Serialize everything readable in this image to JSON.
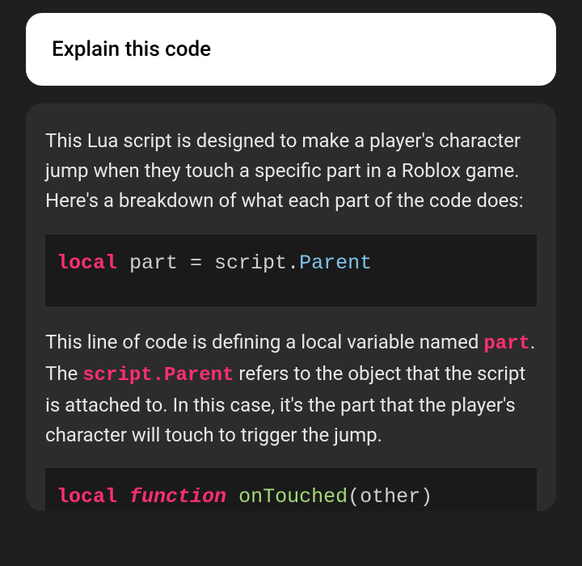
{
  "user": {
    "text": "Explain this code"
  },
  "assistant": {
    "intro": "This Lua script is designed to make a player's character jump when they touch a specific part in a Roblox game. Here's a breakdown of what each part of the code does:",
    "code1": {
      "tokens": {
        "kw_local": "local",
        "id_part": " part ",
        "op_eq": "= ",
        "id_script": "script",
        "op_dot": ".",
        "prop_parent": "Parent"
      }
    },
    "para1_pre": "This line of code is defining a local variable named ",
    "para1_hl1": "part",
    "para1_mid": ". The ",
    "para1_hl2": "script.Parent",
    "para1_post": " refers to the object that the script is attached to. In this case, it's the part that the player's character will touch to trigger the jump.",
    "code2": {
      "tokens": {
        "kw_local": "local",
        "sp1": " ",
        "kw_function": "function",
        "sp2": " ",
        "fn_name": "onTouched",
        "paren_open": "(",
        "arg_other": "other",
        "paren_close": ")"
      }
    }
  }
}
